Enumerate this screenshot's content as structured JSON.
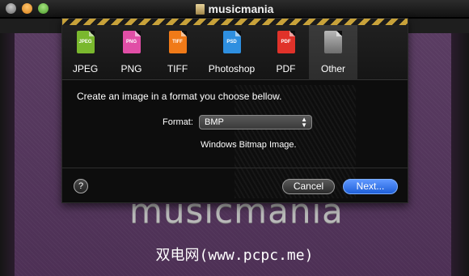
{
  "window": {
    "title": "musicmania"
  },
  "background": {
    "logo_text": "musicmania",
    "watermark_text": "双电网(www.pcpc.me)"
  },
  "dialog": {
    "tabs": [
      {
        "label": "JPEG",
        "icon": "jpeg-file-icon",
        "ext": "JPEG",
        "color": "#7ab82e"
      },
      {
        "label": "PNG",
        "icon": "png-file-icon",
        "ext": "PNG",
        "color": "#e04ea6"
      },
      {
        "label": "TIFF",
        "icon": "tiff-file-icon",
        "ext": "TIFF",
        "color": "#f07a18"
      },
      {
        "label": "Photoshop",
        "icon": "psd-file-icon",
        "ext": "PSD",
        "color": "#2e8fe0"
      },
      {
        "label": "PDF",
        "icon": "pdf-file-icon",
        "ext": "PDF",
        "color": "#e0322a"
      },
      {
        "label": "Other",
        "icon": "generic-file-icon",
        "ext": "",
        "color": "#9a9a9a",
        "selected": true
      }
    ],
    "instructions": "Create an image in a format you choose bellow.",
    "format_label": "Format:",
    "format_value": "BMP",
    "format_description": "Windows Bitmap Image.",
    "help_label": "?",
    "cancel_label": "Cancel",
    "next_label": "Next..."
  }
}
